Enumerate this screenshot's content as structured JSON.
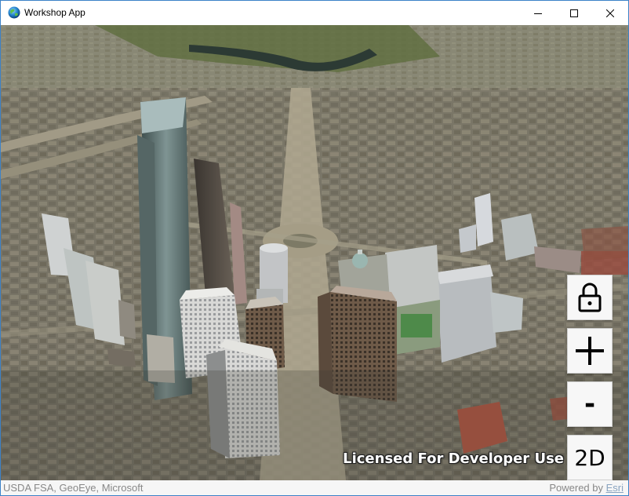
{
  "window": {
    "title": "Workshop App",
    "app_icon": "globe-icon",
    "controls": {
      "minimize": "minimize-icon",
      "maximize": "maximize-icon",
      "close": "close-icon"
    }
  },
  "map_controls": {
    "lock_icon": "lock-icon",
    "zoom_in_icon": "plus-icon",
    "zoom_out_label": "-",
    "view_toggle_label": "2D"
  },
  "overlay": {
    "license_text": "Licensed For Developer Use"
  },
  "attribution": {
    "sources": "USDA FSA, GeoEye, Microsoft",
    "powered_by_prefix": "Powered by ",
    "powered_by_link": "Esri"
  },
  "colors": {
    "window_border": "#3c82c8",
    "button_bg": "#f7f7f7",
    "attribution_bg": "#f5f5f5"
  }
}
